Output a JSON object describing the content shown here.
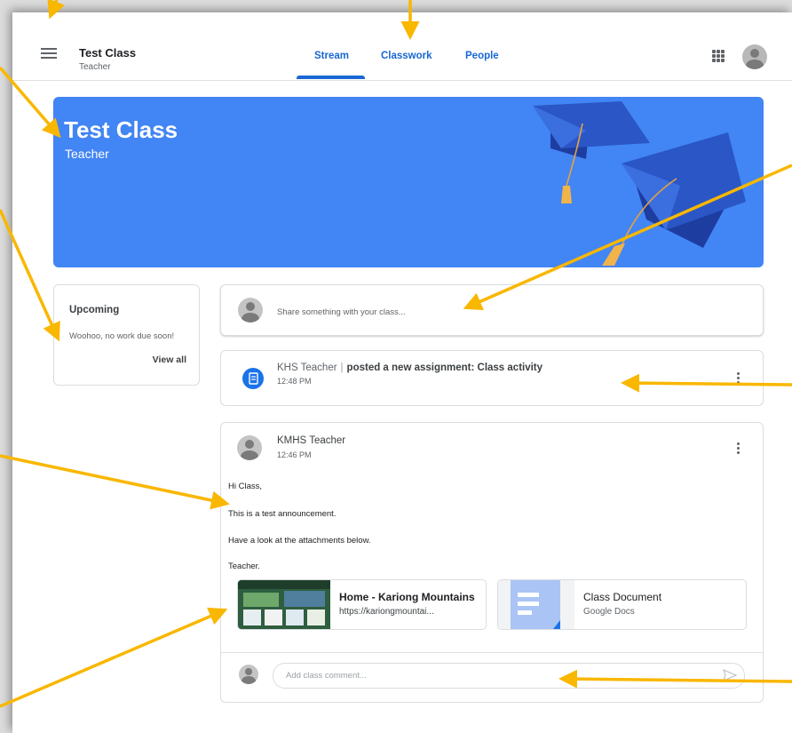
{
  "header": {
    "class_name": "Test Class",
    "class_role": "Teacher",
    "tabs": [
      {
        "label": "Stream",
        "active": true
      },
      {
        "label": "Classwork",
        "active": false
      },
      {
        "label": "People",
        "active": false
      }
    ]
  },
  "banner": {
    "title": "Test Class",
    "subtitle": "Teacher",
    "color": "#4285f4"
  },
  "upcoming": {
    "title": "Upcoming",
    "text": "Woohoo, no work due soon!",
    "link": "View all"
  },
  "share": {
    "placeholder": "Share something with your class..."
  },
  "assignment_post": {
    "author": "KHS Teacher",
    "action": "posted a new assignment: Class activity",
    "time": "12:48 PM"
  },
  "announcement": {
    "author": "KMHS Teacher",
    "time": "12:46 PM",
    "body": [
      "Hi Class,",
      "This is a test announcement.",
      "Have a look at the attachments below.",
      "Teacher."
    ],
    "attachments": [
      {
        "title": "Home - Kariong Mountains",
        "subtitle": "https://kariongmountai..."
      },
      {
        "title": "Class Document",
        "subtitle": "Google Docs"
      }
    ],
    "comment_placeholder": "Add class comment..."
  },
  "colors": {
    "accent": "#1967d2",
    "arrow": "#f9b700"
  }
}
